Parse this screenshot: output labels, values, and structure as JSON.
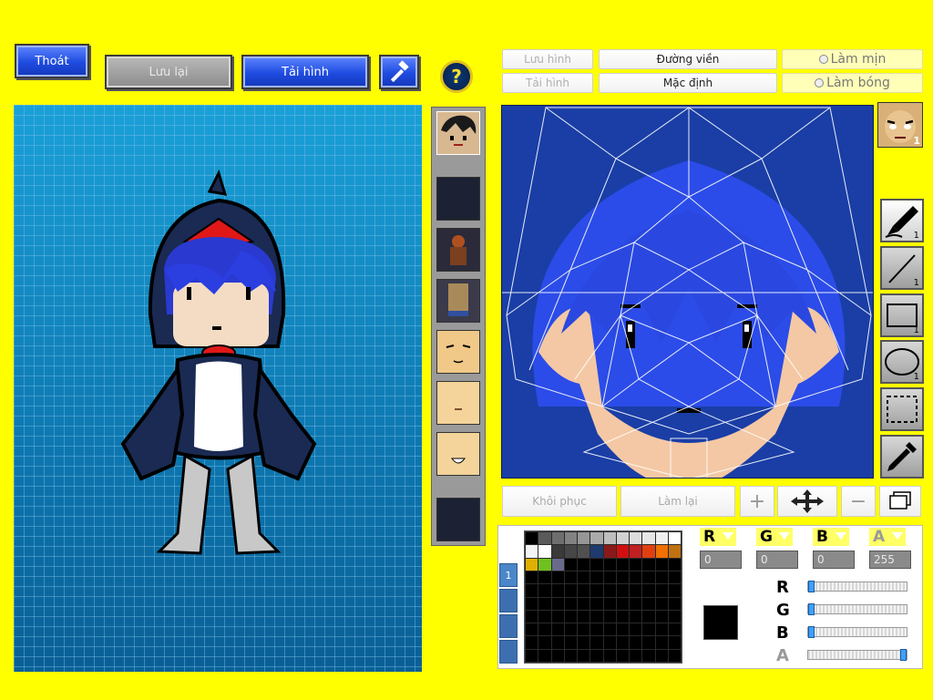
{
  "toolbar": {
    "exit_label": "Thoát",
    "save_label": "Lưu lại",
    "reload_label": "Tải hình",
    "help_symbol": "?"
  },
  "editor_top": {
    "save_image": "Lưu hình",
    "load_image": "Tải hình",
    "outline": "Đường viền",
    "default": "Mặc định",
    "smooth": "Làm mịn",
    "shine": "Làm bóng"
  },
  "right_portrait": {
    "badge": "1"
  },
  "tools": [
    {
      "name": "brush",
      "count": "1"
    },
    {
      "name": "line",
      "count": "1"
    },
    {
      "name": "rectangle",
      "count": "1"
    },
    {
      "name": "ellipse",
      "count": "1"
    },
    {
      "name": "select",
      "count": ""
    },
    {
      "name": "eyedropper",
      "count": ""
    }
  ],
  "bottom_buttons": {
    "restore": "Khôi phục",
    "redo": "Làm lại",
    "plus_symbol": "+",
    "minus_symbol": "−"
  },
  "color": {
    "channels": [
      "R",
      "G",
      "B",
      "A"
    ],
    "values": [
      "0",
      "0",
      "0",
      "255"
    ],
    "slider_levels": [
      0,
      0,
      0,
      1
    ],
    "current": "#000000",
    "palette_tab": "1",
    "palette": [
      "#000000",
      "#5a5a5a",
      "#6e6e6e",
      "#828282",
      "#969696",
      "#aaaaaa",
      "#bebebe",
      "#d2d2d2",
      "#dcdcdc",
      "#e6e6e6",
      "#f0f0f0",
      "#ffffff",
      "#f4f4f4",
      "#ffffff",
      "#3a3a3a",
      "#464646",
      "#505050",
      "#1e3a6e",
      "#8a1a1a",
      "#d01010",
      "#c02020",
      "#e04010",
      "#f07000",
      "#c07010",
      "#e0b000",
      "#70c020",
      "#6a6a8a"
    ]
  },
  "colors": {
    "background": "#ffff00",
    "button_blue": "#1e4be0",
    "canvas_blue": "#1a7fb8",
    "editor_blue": "#1a3ea6"
  }
}
